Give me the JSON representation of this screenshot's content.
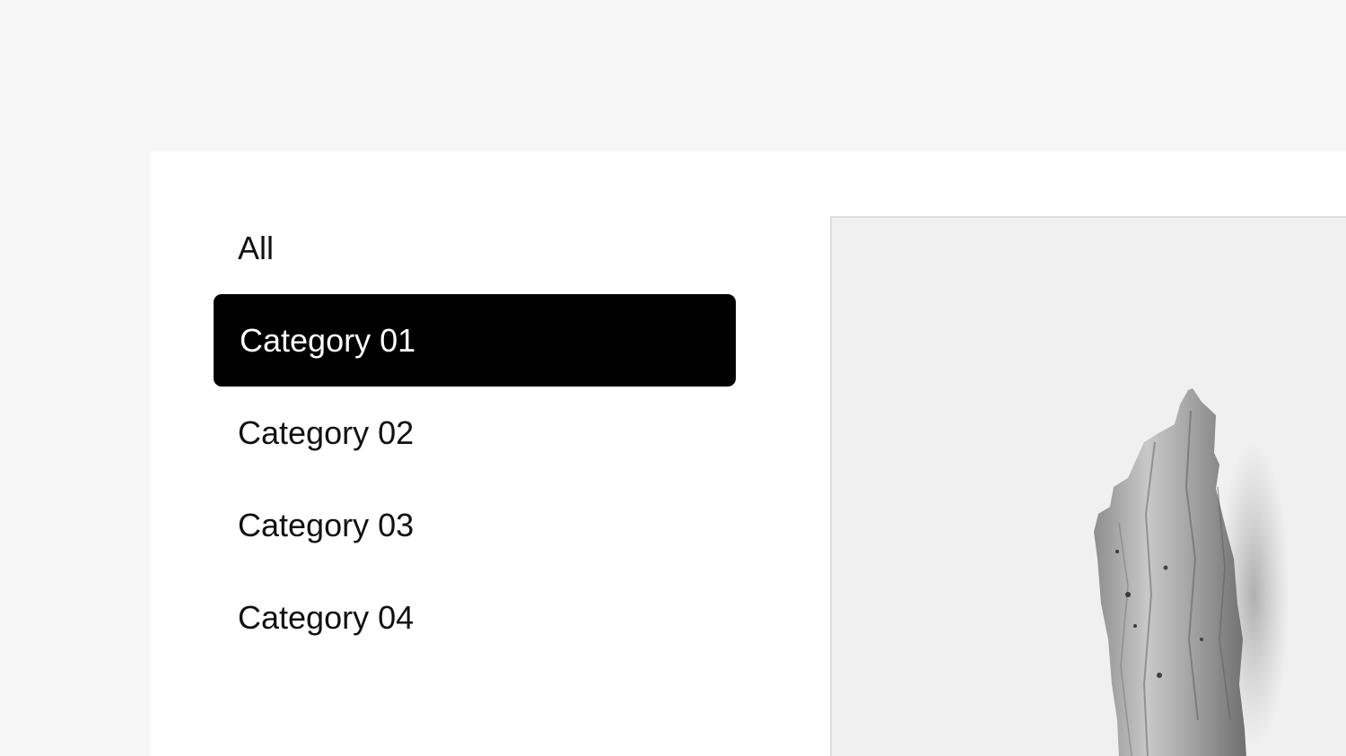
{
  "categories": {
    "items": [
      {
        "label": "All"
      },
      {
        "label": "Category 01",
        "active": true
      },
      {
        "label": "Category 02"
      },
      {
        "label": "Category 03"
      },
      {
        "label": "Category 04"
      }
    ]
  },
  "preview": {
    "subject": "driftwood-image"
  },
  "colors": {
    "page_background": "#f7f7f7",
    "panel_background": "#ffffff",
    "active_background": "#000000",
    "active_text": "#ffffff",
    "text": "#111111",
    "preview_background": "#f0f0f1"
  }
}
